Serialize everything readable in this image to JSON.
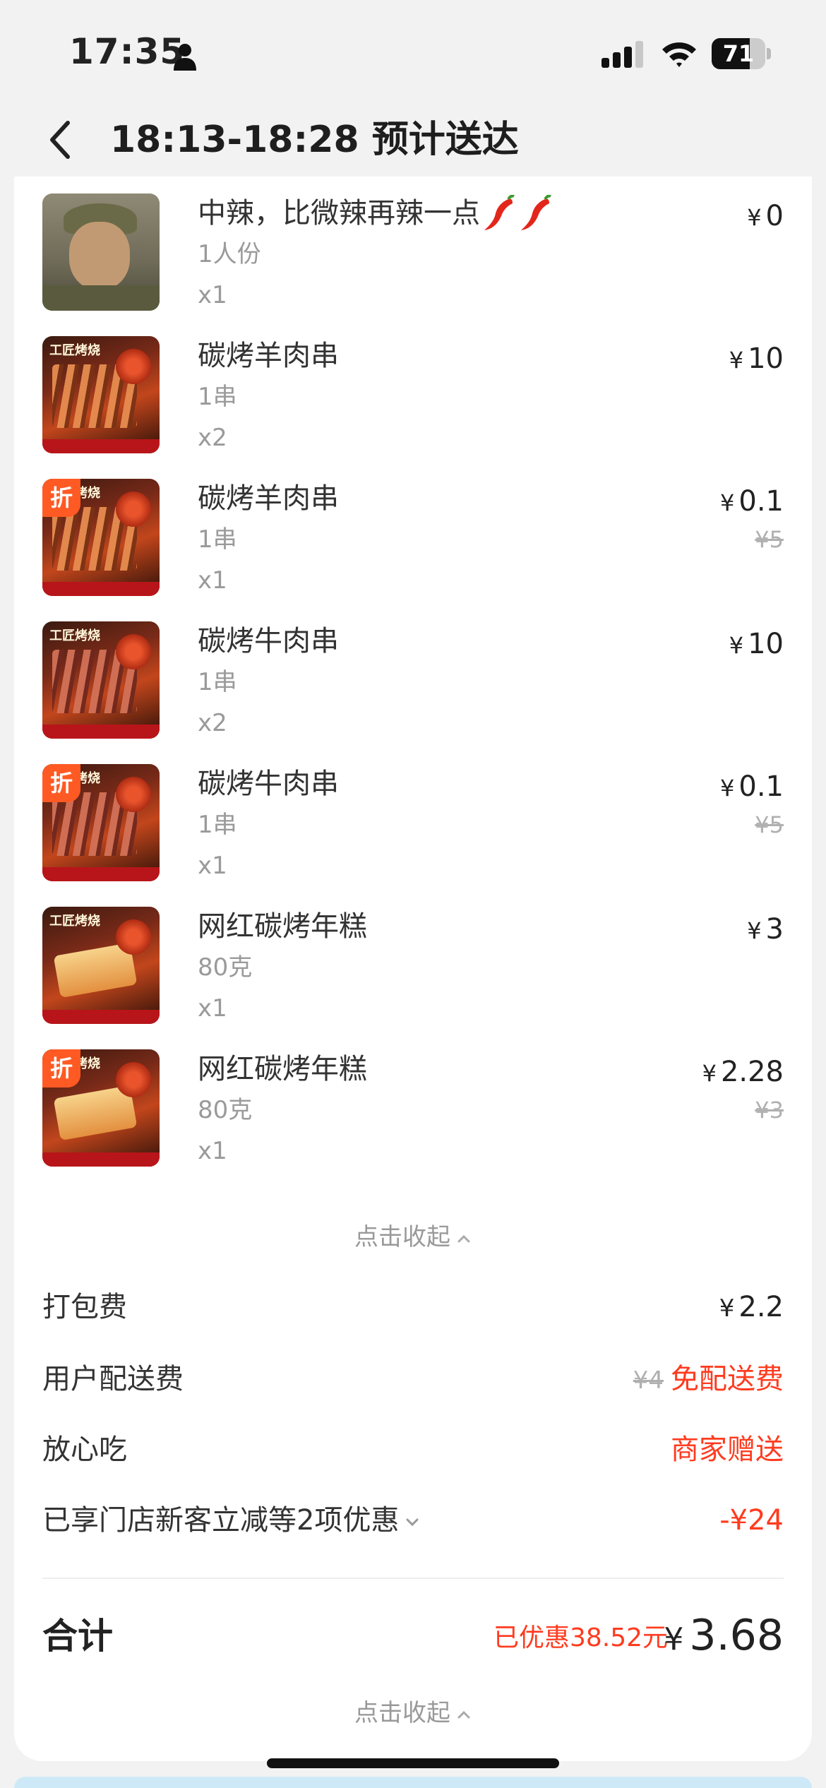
{
  "status_bar": {
    "time": "17:35",
    "battery": "71",
    "battery_level": 0.71
  },
  "header": {
    "title": "18:13-18:28 预计送达"
  },
  "items": [
    {
      "name": "中辣，比微辣再辣一点",
      "spec": "1人份",
      "qty": "x1",
      "price": "0",
      "orig_price": "",
      "discount": false,
      "thumb": "person-photo",
      "chili": true
    },
    {
      "name": "碳烤羊肉串",
      "spec": "1串",
      "qty": "x2",
      "price": "10",
      "orig_price": "",
      "discount": false,
      "thumb": "lamb-skewers"
    },
    {
      "name": "碳烤羊肉串",
      "spec": "1串",
      "qty": "x1",
      "price": "0.1",
      "orig_price": "¥5",
      "discount": true,
      "thumb": "lamb-skewers"
    },
    {
      "name": "碳烤牛肉串",
      "spec": "1串",
      "qty": "x2",
      "price": "10",
      "orig_price": "",
      "discount": false,
      "thumb": "beef-skewers"
    },
    {
      "name": "碳烤牛肉串",
      "spec": "1串",
      "qty": "x1",
      "price": "0.1",
      "orig_price": "¥5",
      "discount": true,
      "thumb": "beef-skewers"
    },
    {
      "name": "网红碳烤年糕",
      "spec": "80克",
      "qty": "x1",
      "price": "3",
      "orig_price": "",
      "discount": false,
      "thumb": "rice-cake"
    },
    {
      "name": "网红碳烤年糕",
      "spec": "80克",
      "qty": "x1",
      "price": "2.28",
      "orig_price": "¥3",
      "discount": true,
      "thumb": "rice-cake"
    }
  ],
  "currency": "¥",
  "discount_badge": "折",
  "collapse_label": "点击收起",
  "fees": {
    "packing": {
      "label": "打包费",
      "value": "2.2"
    },
    "delivery": {
      "label": "用户配送费",
      "orig": "¥4",
      "value": "免配送费"
    },
    "assurance": {
      "label": "放心吃",
      "value": "商家赠送"
    },
    "promo": {
      "label": "已享门店新客立减等2项优惠",
      "value": "-¥24"
    }
  },
  "total": {
    "label": "合计",
    "saved": "已优惠38.52元",
    "amount": "3.68"
  },
  "colors": {
    "accent_red": "#ff3b1f",
    "badge_orange": "#ff5a24"
  }
}
